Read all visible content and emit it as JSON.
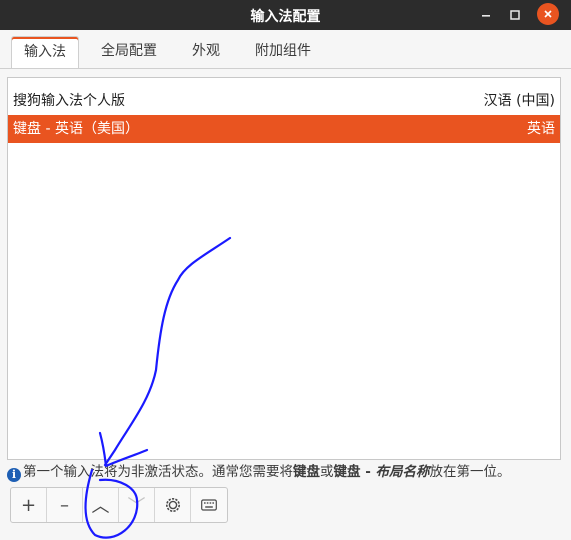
{
  "window": {
    "title": "输入法配置",
    "minimize_label": "–",
    "maximize_label": "□",
    "close_label": "×"
  },
  "tabs": [
    {
      "label": "输入法",
      "active": true
    },
    {
      "label": "全局配置",
      "active": false
    },
    {
      "label": "外观",
      "active": false
    },
    {
      "label": "附加组件",
      "active": false
    }
  ],
  "input_methods": [
    {
      "name": "搜狗输入法个人版",
      "language": "汉语 (中国)",
      "selected": false
    },
    {
      "name": "键盘 - 英语（美国）",
      "language": "英语",
      "selected": true
    }
  ],
  "info": {
    "icon": "i",
    "text_1": "第一个输入法将为非激活状态。通常您需要将",
    "bold_1": "键盘",
    "text_2": "或",
    "bold_2": "键盘 - ",
    "italic_bold": "布局名称",
    "text_3": "放在第一位。"
  },
  "toolbar": {
    "add": "+",
    "remove": "–",
    "move_up": "︿",
    "move_down": "﹀"
  },
  "colors": {
    "accent": "#e95420",
    "titlebar": "#2c2c2c",
    "annotation_ink": "#1a1aff"
  }
}
